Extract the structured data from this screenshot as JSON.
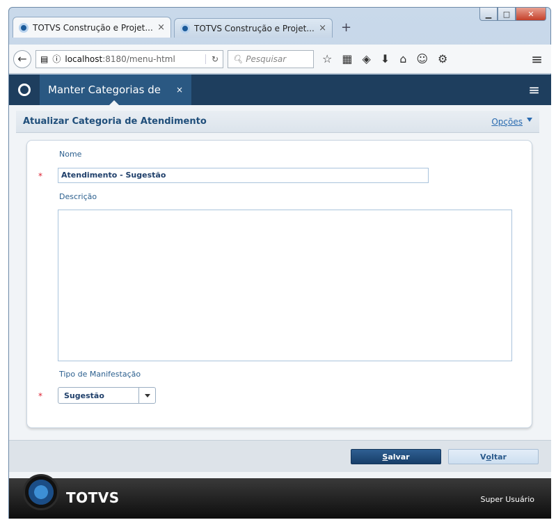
{
  "browser": {
    "tabs": [
      {
        "title": "TOTVS Construção e Projet...",
        "active": true
      },
      {
        "title": "TOTVS Construção e Projet...",
        "active": false
      }
    ],
    "new_tab_symbol": "+",
    "close_symbol": "×",
    "url_host": "localhost",
    "url_rest": ":8180/menu-html",
    "search_placeholder": "Pesquisar"
  },
  "app": {
    "tab_label": "Manter Categorias de",
    "tab_close": "×",
    "panel_title": "Atualizar Categoria de Atendimento",
    "options_label": "Opções"
  },
  "form": {
    "name_label": "Nome",
    "name_value": "Atendimento - Sugestão",
    "description_label": "Descrição",
    "description_value": "",
    "type_label": "Tipo de Manifestação",
    "type_value": "Sugestão",
    "required_marker": "*"
  },
  "buttons": {
    "save_underlined": "S",
    "save_rest": "alvar",
    "back_first": "V",
    "back_underlined": "o",
    "back_rest": "ltar"
  },
  "footer": {
    "brand": "TOTVS",
    "user": "Super Usuário"
  },
  "colors": {
    "header_bg": "#1e3e5e",
    "active_tab_bg": "#2a5882",
    "save_button": "#1f4b7c",
    "panel_title": "#1f4e7a"
  }
}
